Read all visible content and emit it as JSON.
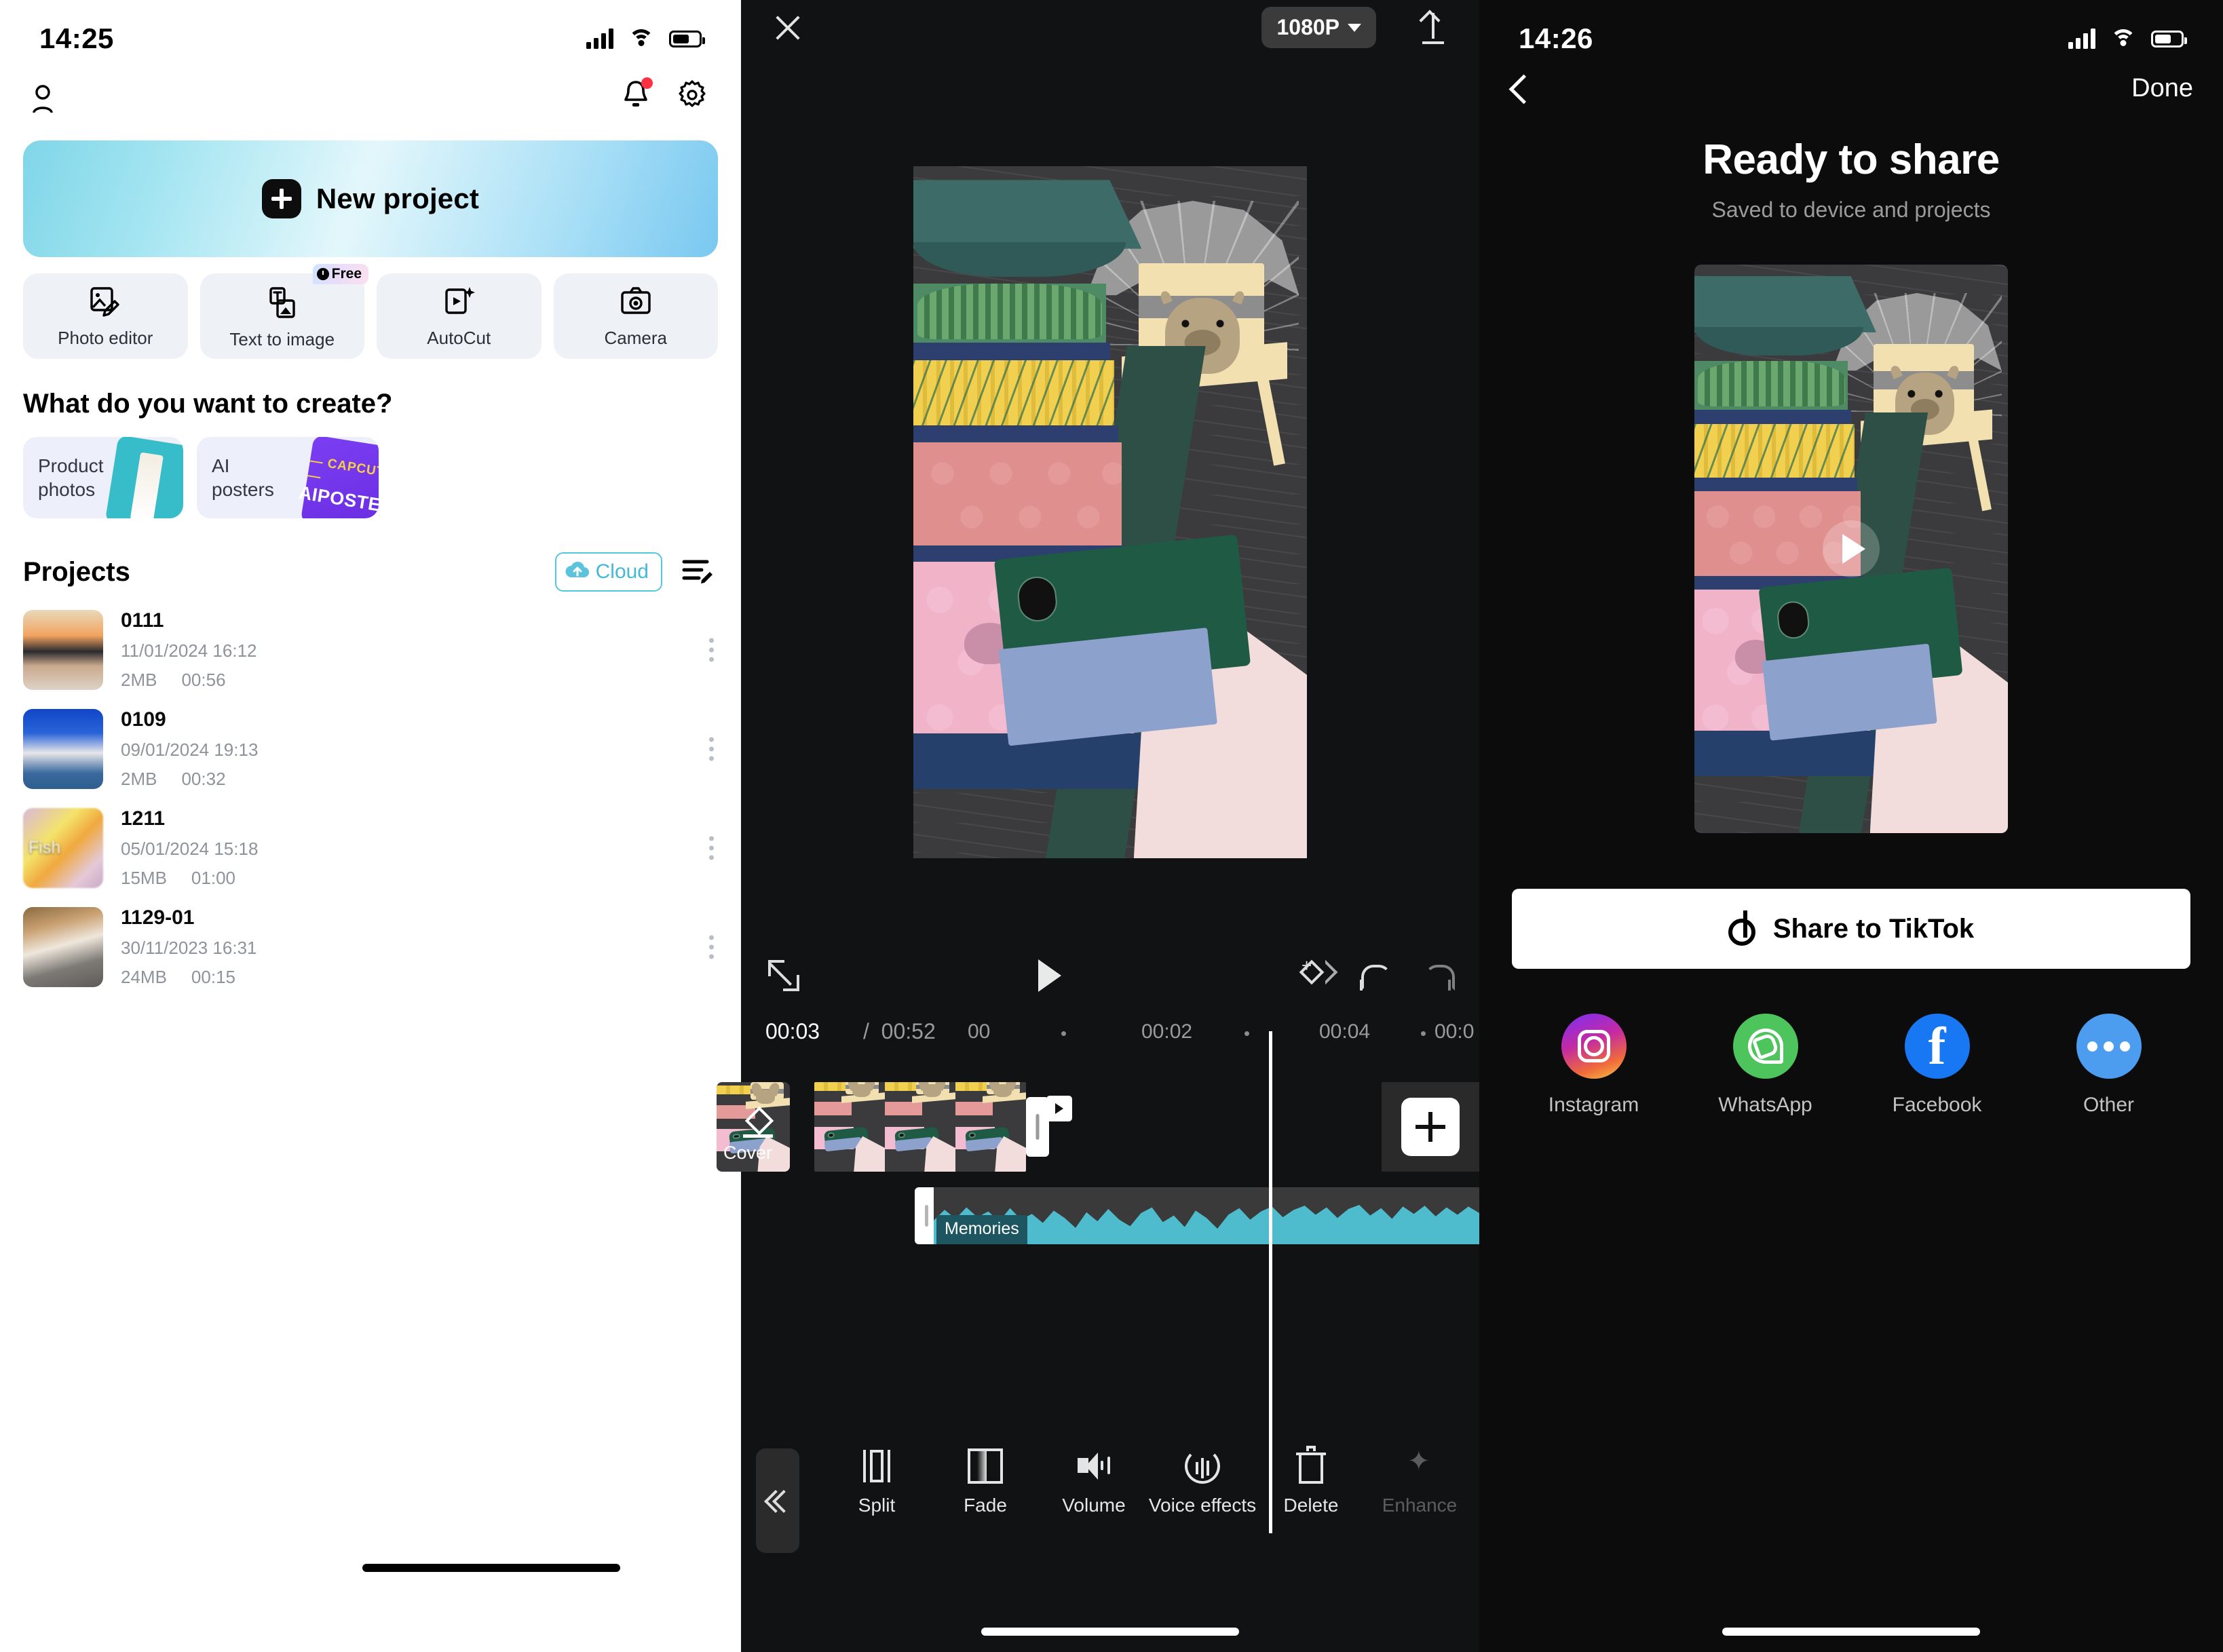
{
  "home": {
    "status": {
      "time": "14:25"
    },
    "topbar": {
      "profile_icon": "person-icon",
      "bell_icon": "bell-icon",
      "settings_icon": "gear-icon"
    },
    "new_project": {
      "label": "New project",
      "icon": "plus-icon"
    },
    "quick_actions": [
      {
        "label": "Photo editor",
        "icon": "photo-edit-icon",
        "badge": ""
      },
      {
        "label": "Text to image",
        "icon": "text-to-image-icon",
        "badge": "Free"
      },
      {
        "label": "AutoCut",
        "icon": "autocut-icon",
        "badge": ""
      },
      {
        "label": "Camera",
        "icon": "camera-icon",
        "badge": ""
      }
    ],
    "create_section": {
      "title": "What do you want to create?",
      "cards": [
        {
          "label": "Product photos"
        },
        {
          "label": "AI posters",
          "art_line1": "— CAPCUT —",
          "art_line2": "AIPOSTER"
        }
      ]
    },
    "projects_section": {
      "title": "Projects",
      "cloud_label": "Cloud",
      "sort_icon": "sort-edit-icon",
      "items": [
        {
          "name": "0111",
          "date": "11/01/2024 16:12",
          "size": "2MB",
          "duration": "00:56",
          "thumb_label": ""
        },
        {
          "name": "0109",
          "date": "09/01/2024 19:13",
          "size": "2MB",
          "duration": "00:32",
          "thumb_label": ""
        },
        {
          "name": "1211",
          "date": "05/01/2024 15:18",
          "size": "15MB",
          "duration": "01:00",
          "thumb_label": "Fish"
        },
        {
          "name": "1129-01",
          "date": "30/11/2023 16:31",
          "size": "24MB",
          "duration": "00:15",
          "thumb_label": ""
        }
      ]
    }
  },
  "editor": {
    "close_icon": "close-icon",
    "resolution": "1080P",
    "export_icon": "upload-icon",
    "controls": {
      "fullscreen_icon": "expand-icon",
      "play_icon": "play-icon",
      "keyframe_icon": "keyframe-icon",
      "undo_icon": "undo-icon",
      "redo_icon": "redo-icon"
    },
    "timeline": {
      "current_time": "00:03",
      "separator": "/",
      "total_time": "00:52",
      "ticks": [
        "00",
        "00:02",
        "00:04",
        "00:0"
      ],
      "cover_label": "Cover",
      "add_clip_icon": "plus-icon",
      "audio_label": "Memories"
    },
    "toolbar": {
      "collapse_icon": "double-chevron-left-icon",
      "tools": [
        {
          "label": "Split",
          "icon": "split-icon",
          "disabled": false
        },
        {
          "label": "Fade",
          "icon": "fade-icon",
          "disabled": false
        },
        {
          "label": "Volume",
          "icon": "volume-icon",
          "disabled": false
        },
        {
          "label": "Voice effects",
          "icon": "voice-effects-icon",
          "disabled": false
        },
        {
          "label": "Delete",
          "icon": "trash-icon",
          "disabled": false
        },
        {
          "label": "Enhance",
          "icon": "enhance-icon",
          "disabled": true
        }
      ]
    }
  },
  "share": {
    "status": {
      "time": "14:26"
    },
    "back_icon": "chevron-left-icon",
    "done_label": "Done",
    "title": "Ready to share",
    "subtitle": "Saved to device and projects",
    "preview_play_icon": "play-icon",
    "tiktok_button": {
      "label": "Share to TikTok",
      "icon": "tiktok-icon"
    },
    "targets": [
      {
        "label": "Instagram",
        "icon": "instagram-icon",
        "color": "#c32aa3"
      },
      {
        "label": "WhatsApp",
        "icon": "whatsapp-icon",
        "color": "#4ec45c"
      },
      {
        "label": "Facebook",
        "icon": "facebook-icon",
        "color": "#1877f2"
      },
      {
        "label": "Other",
        "icon": "ellipsis-icon",
        "color": "#4c9cf0"
      }
    ]
  }
}
